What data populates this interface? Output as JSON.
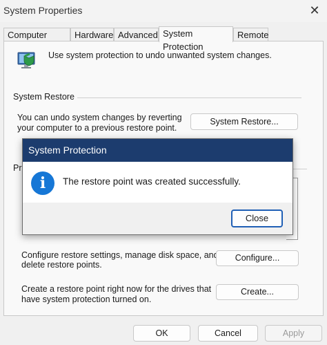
{
  "window": {
    "title": "System Properties",
    "close_glyph": "✕"
  },
  "tabs": [
    {
      "label": "Computer Name"
    },
    {
      "label": "Hardware"
    },
    {
      "label": "Advanced"
    },
    {
      "label": "System Protection"
    },
    {
      "label": "Remote"
    }
  ],
  "intro": {
    "text": "Use system protection to undo unwanted system changes.",
    "icon": "computer-shield-icon"
  },
  "system_restore": {
    "heading": "System Restore",
    "description_line1": "You can undo system changes by reverting",
    "description_line2": "your computer to a previous restore point.",
    "button": "System Restore..."
  },
  "protection_settings": {
    "heading_visible": "Pr"
  },
  "configure": {
    "line1": "Configure restore settings, manage disk space, and",
    "line2": "delete restore points.",
    "button": "Configure..."
  },
  "create": {
    "line1": "Create a restore point right now for the drives that",
    "line2": "have system protection turned on.",
    "button": "Create..."
  },
  "footer": {
    "ok": "OK",
    "cancel": "Cancel",
    "apply": "Apply"
  },
  "dialog": {
    "title": "System Protection",
    "message": "The restore point was created successfully.",
    "icon": "info-icon",
    "icon_glyph": "i",
    "close_button": "Close"
  },
  "colors": {
    "dialog_title_bar": "#1c3c6e",
    "info_icon": "#1677d6",
    "primary_button_border": "#1f5fb5"
  }
}
